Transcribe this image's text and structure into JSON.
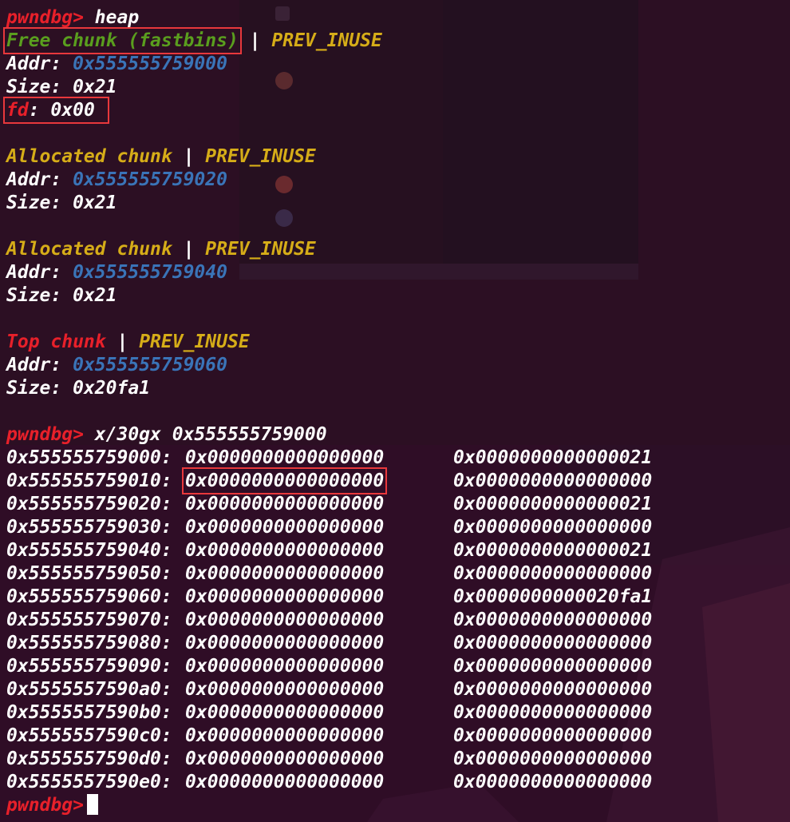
{
  "prompt": "pwndbg>",
  "colors": {
    "background": "#2c0f23",
    "prompt": "#e8202a",
    "free_chunk": "#5a9e1e",
    "allocated_chunk": "#d6ad18",
    "prev_inuse": "#d6ad18",
    "address": "#3a74b8",
    "top_chunk": "#e8202a",
    "highlight_box": "#e8383c"
  },
  "heap_cmd": "heap",
  "sep": "|",
  "chunks": [
    {
      "title": "Free chunk (fastbins)",
      "flag": "PREV_INUSE",
      "addr_label": "Addr:",
      "addr": "0x555555759000",
      "size_label": "Size:",
      "size": "0x21",
      "fd_label": "fd",
      "fd_rest": ": 0x00"
    },
    {
      "title": "Allocated chunk",
      "flag": "PREV_INUSE",
      "addr_label": "Addr:",
      "addr": "0x555555759020",
      "size_label": "Size:",
      "size": "0x21"
    },
    {
      "title": "Allocated chunk",
      "flag": "PREV_INUSE",
      "addr_label": "Addr:",
      "addr": "0x555555759040",
      "size_label": "Size:",
      "size": "0x21"
    },
    {
      "title": "Top chunk",
      "flag": "PREV_INUSE",
      "addr_label": "Addr:",
      "addr": "0x555555759060",
      "size_label": "Size:",
      "size": "0x20fa1"
    }
  ],
  "dump_cmd": "x/30gx 0x555555759000",
  "dump": [
    {
      "addr": "0x555555759000:",
      "q1": "0x0000000000000000",
      "q2": "0x0000000000000021"
    },
    {
      "addr": "0x555555759010:",
      "q1": "0x0000000000000000",
      "q2": "0x0000000000000000"
    },
    {
      "addr": "0x555555759020:",
      "q1": "0x0000000000000000",
      "q2": "0x0000000000000021"
    },
    {
      "addr": "0x555555759030:",
      "q1": "0x0000000000000000",
      "q2": "0x0000000000000000"
    },
    {
      "addr": "0x555555759040:",
      "q1": "0x0000000000000000",
      "q2": "0x0000000000000021"
    },
    {
      "addr": "0x555555759050:",
      "q1": "0x0000000000000000",
      "q2": "0x0000000000000000"
    },
    {
      "addr": "0x555555759060:",
      "q1": "0x0000000000000000",
      "q2": "0x0000000000020fa1"
    },
    {
      "addr": "0x555555759070:",
      "q1": "0x0000000000000000",
      "q2": "0x0000000000000000"
    },
    {
      "addr": "0x555555759080:",
      "q1": "0x0000000000000000",
      "q2": "0x0000000000000000"
    },
    {
      "addr": "0x555555759090:",
      "q1": "0x0000000000000000",
      "q2": "0x0000000000000000"
    },
    {
      "addr": "0x5555557590a0:",
      "q1": "0x0000000000000000",
      "q2": "0x0000000000000000"
    },
    {
      "addr": "0x5555557590b0:",
      "q1": "0x0000000000000000",
      "q2": "0x0000000000000000"
    },
    {
      "addr": "0x5555557590c0:",
      "q1": "0x0000000000000000",
      "q2": "0x0000000000000000"
    },
    {
      "addr": "0x5555557590d0:",
      "q1": "0x0000000000000000",
      "q2": "0x0000000000000000"
    },
    {
      "addr": "0x5555557590e0:",
      "q1": "0x0000000000000000",
      "q2": "0x0000000000000000"
    }
  ]
}
